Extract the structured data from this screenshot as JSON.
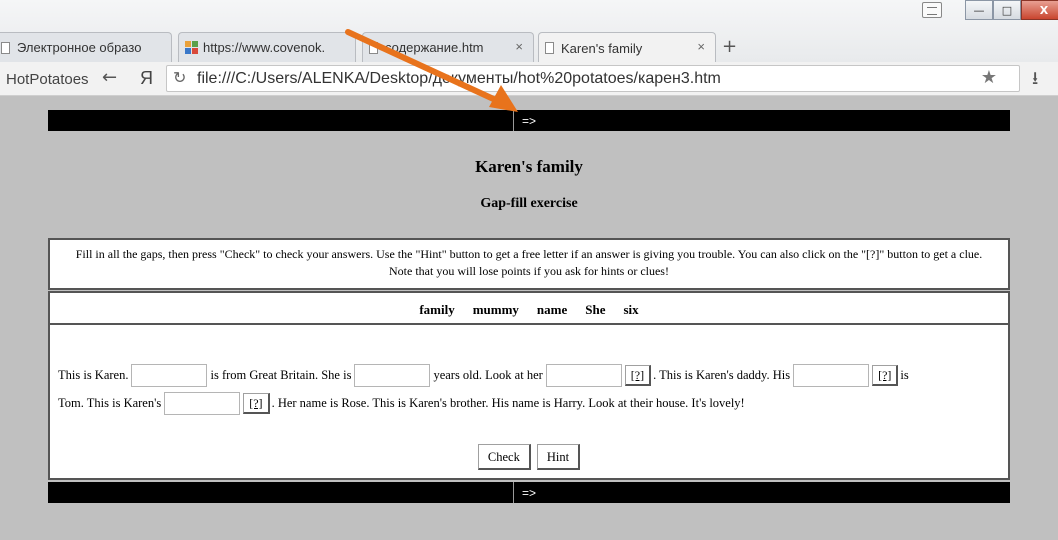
{
  "browser": {
    "tabs": [
      {
        "label": "Электронное образо",
        "icon": "document-icon"
      },
      {
        "label": "https://www.covenok.",
        "icon": "colored-grid-icon"
      },
      {
        "label": "содержание.htm",
        "icon": "document-icon"
      },
      {
        "label": "Karen's family",
        "icon": "document-icon",
        "active": true
      }
    ],
    "new_tab": "+",
    "close_glyph": "×",
    "bookmark_label": "HotPotatoes",
    "back_glyph": "←",
    "yandex_glyph": "Я",
    "reload_glyph": "↻",
    "url": "file:///C:/Users/ALENKA/Desktop/документы/hot%20potatoes/карен3.htm",
    "star_glyph": "★",
    "download_glyph": "⭳",
    "window_buttons": {
      "minimize": "—",
      "maximize": "□",
      "close": "X"
    }
  },
  "page": {
    "nav_arrow": "=>",
    "title": "Karen's family",
    "subtitle": "Gap-fill exercise",
    "instructions": "Fill in all the gaps, then press \"Check\" to check your answers. Use the \"Hint\" button to get a free letter if an answer is giving you trouble. You can also click on the \"[?]\" button to get a clue. Note that you will lose points if you ask for hints or clues!",
    "word_bank": [
      "family",
      "mummy",
      "name",
      "She",
      "six"
    ],
    "exercise": {
      "t1": "This is Karen.",
      "t2": "is from Great Britain. She is",
      "t3": "years old. Look at her",
      "t4": ". This is Karen's daddy. His",
      "t5": "is",
      "t6": "Tom. This is Karen's",
      "t7": ". Her name is Rose. This is Karen's brother. His name is Harry. Look at their house. It's lovely!",
      "clue": "[?]"
    },
    "check_label": "Check",
    "hint_label": "Hint"
  },
  "colors": {
    "page_bg": "#c0c0c0",
    "nav_bar": "#000000",
    "annotation_arrow": "#e8731c"
  }
}
